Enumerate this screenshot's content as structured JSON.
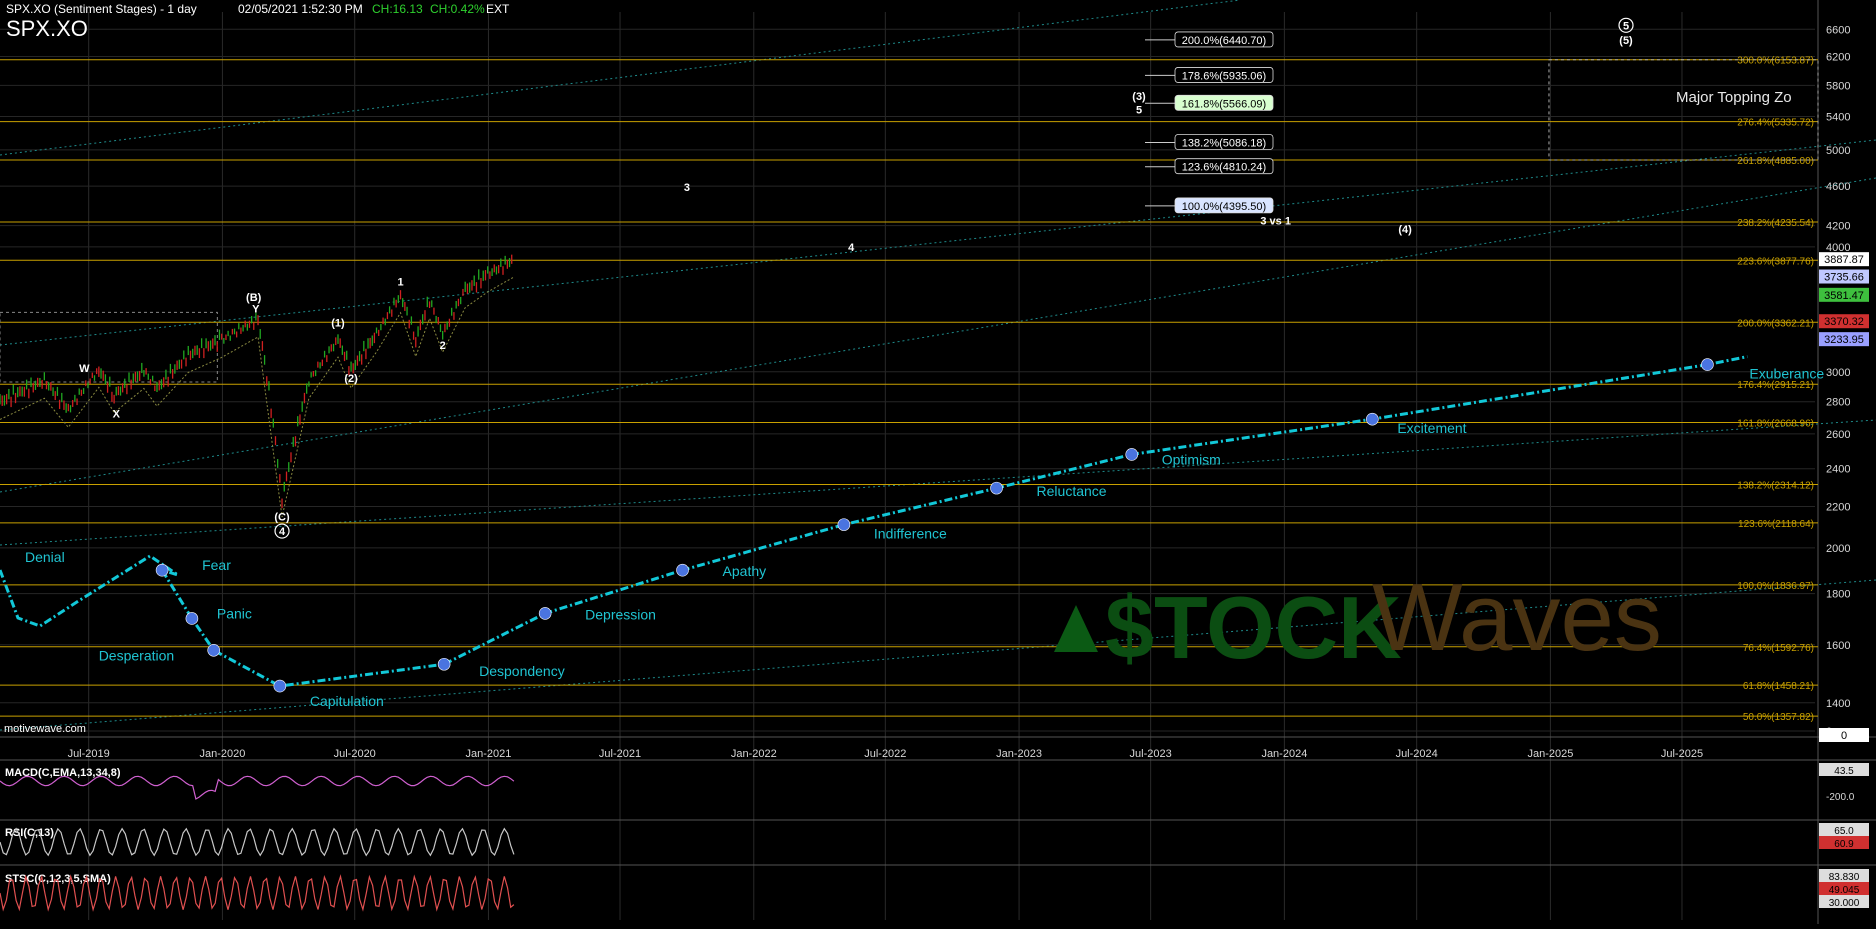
{
  "header": {
    "instrument": "SPX.XO (Sentiment Stages) - 1 day",
    "datetime": "02/05/2021 1:52:30 PM",
    "change": "CH:16.13",
    "change_pct": "CH:0.42%",
    "session": "EXT",
    "symbol": "SPX.XO"
  },
  "watermark": {
    "brand": "motivewave.com",
    "logo_part1": "$TOCK",
    "logo_part2": "Waves"
  },
  "colors": {
    "fib_line": "#c8a000",
    "sentiment_curve": "#12c8d8",
    "stage_marker": "#4a74e0",
    "stage_label": "#20c4d2",
    "up_candle": "#21a821",
    "down_candle": "#d02020"
  },
  "chart_data": [
    {
      "type": "line",
      "title": "SPX.XO (Sentiment Stages) - 1 day",
      "log_scale": true,
      "grid": true,
      "x_ticks": [
        "Jul-2019",
        "Jan-2020",
        "Jul-2020",
        "Jan-2021",
        "Jul-2021",
        "Jan-2022",
        "Jul-2022",
        "Jan-2023",
        "Jul-2023",
        "Jan-2024",
        "Jul-2024",
        "Jan-2025",
        "Jul-2025"
      ],
      "x_range": [
        "2019-03-01",
        "2025-12-31"
      ],
      "y_ticks": [
        6600,
        6200,
        5800,
        5400,
        5000,
        4600,
        4200,
        4000,
        3000,
        2800,
        2600,
        2400,
        2200,
        2000,
        1800,
        1600,
        1400,
        0
      ],
      "ylim": [
        1300,
        6900
      ],
      "price_series": {
        "name": "SPX",
        "x": [
          "2019-03-01",
          "2019-05-01",
          "2019-06-03",
          "2019-07-15",
          "2019-08-05",
          "2019-09-15",
          "2019-10-03",
          "2019-11-15",
          "2019-12-31",
          "2020-02-19",
          "2020-03-23",
          "2020-04-29",
          "2020-06-08",
          "2020-06-26",
          "2020-07-31",
          "2020-09-02",
          "2020-09-23",
          "2020-10-12",
          "2020-10-30",
          "2020-11-30",
          "2020-12-31",
          "2021-02-05"
        ],
        "y": [
          2800,
          2940,
          2750,
          3015,
          2845,
          3007,
          2887,
          3120,
          3230,
          3386,
          2237,
          2940,
          3232,
          3010,
          3271,
          3580,
          3237,
          3534,
          3270,
          3622,
          3756,
          3887
        ]
      },
      "price_labels": [
        {
          "text": "3887.87",
          "value": 3887.87,
          "color": "#ffffff"
        },
        {
          "text": "3735.66",
          "value": 3735.66,
          "color": "#c0c8ff"
        },
        {
          "text": "3581.47",
          "value": 3581.47,
          "color": "#3ec03e"
        },
        {
          "text": "3370.32",
          "value": 3370.32,
          "color": "#d03030"
        },
        {
          "text": "3233.95",
          "value": 3233.95,
          "color": "#9aa0ff"
        },
        {
          "text": "0",
          "value": 1300,
          "color": "#ffffff"
        }
      ],
      "fib_levels": [
        {
          "label": "300.0%(6153.87)",
          "value": 6153.87
        },
        {
          "label": "276.4%(5335.72)",
          "value": 5335.72
        },
        {
          "label": "261.8%(4885.00)",
          "value": 4885.0
        },
        {
          "label": "238.2%(4235.54)",
          "value": 4235.54
        },
        {
          "label": "223.6%(3877.76)",
          "value": 3877.76
        },
        {
          "label": "200.0%(3362.21)",
          "value": 3362.21
        },
        {
          "label": "176.4%(2915.21)",
          "value": 2915.21
        },
        {
          "label": "161.8%(2668.96)",
          "value": 2668.96
        },
        {
          "label": "138.2%(2314.12)",
          "value": 2314.12
        },
        {
          "label": "123.6%(2118.64)",
          "value": 2118.64
        },
        {
          "label": "100.0%(1836.97)",
          "value": 1836.97
        },
        {
          "label": "76.4%(1592.76)",
          "value": 1592.76
        },
        {
          "label": "61.8%(1458.21)",
          "value": 1458.21
        },
        {
          "label": "50.0%(1357.82)",
          "value": 1357.82
        }
      ],
      "extension_targets": [
        {
          "label": "200.0%(6440.70)",
          "value": 6440.7,
          "highlight": "none"
        },
        {
          "label": "178.6%(5935.06)",
          "value": 5935.06,
          "highlight": "none"
        },
        {
          "label": "161.8%(5566.09)",
          "value": 5566.09,
          "highlight": "green"
        },
        {
          "label": "138.2%(5086.18)",
          "value": 5086.18,
          "highlight": "none"
        },
        {
          "label": "123.6%(4810.24)",
          "value": 4810.24,
          "highlight": "none"
        },
        {
          "label": "100.0%(4395.50)",
          "value": 4395.5,
          "highlight": "blue"
        }
      ],
      "wave_labels": [
        {
          "text": "W",
          "x": "2019-06-25",
          "y": 3000
        },
        {
          "text": "X",
          "x": "2019-08-08",
          "y": 2700
        },
        {
          "text": "(B)",
          "x": "2020-02-13",
          "y": 3530
        },
        {
          "text": "Y",
          "x": "2020-02-16",
          "y": 3440
        },
        {
          "text": "(C)",
          "x": "2020-03-23",
          "y": 2130
        },
        {
          "text": "4",
          "x": "2020-03-23",
          "y": 2060,
          "circled": true
        },
        {
          "text": "(1)",
          "x": "2020-06-08",
          "y": 3330
        },
        {
          "text": "(2)",
          "x": "2020-06-26",
          "y": 2930
        },
        {
          "text": "1",
          "x": "2020-09-02",
          "y": 3660
        },
        {
          "text": "2",
          "x": "2020-10-30",
          "y": 3160
        },
        {
          "text": "3",
          "x": "2021-10-01",
          "y": 4550
        },
        {
          "text": "4",
          "x": "2022-05-15",
          "y": 3960
        },
        {
          "text": "(3)",
          "x": "2023-06-15",
          "y": 5610
        },
        {
          "text": "5",
          "x": "2023-06-15",
          "y": 5440
        },
        {
          "text": "3 vs 1",
          "x": "2023-12-20",
          "y": 4210
        },
        {
          "text": "(4)",
          "x": "2024-06-15",
          "y": 4130
        },
        {
          "text": "5",
          "x": "2025-04-15",
          "y": 6600,
          "circled": true
        },
        {
          "text": "(5)",
          "x": "2025-04-15",
          "y": 6380
        }
      ],
      "zones": [
        {
          "label": "Major Topping Zo",
          "x0": "2024-12-30",
          "x1": "2026-01-30",
          "y0": 4885.0,
          "y1": 6153.87
        }
      ],
      "sentiment_stages": [
        {
          "name": "Denial",
          "x": "2019-03-01",
          "y": 1960
        },
        {
          "name": "Fear",
          "x": "2019-10-10",
          "y": 1900
        },
        {
          "name": "Panic",
          "x": "2019-11-20",
          "y": 1700
        },
        {
          "name": "Desperation",
          "x": "2019-12-20",
          "y": 1580
        },
        {
          "name": "Capitulation",
          "x": "2020-03-20",
          "y": 1455
        },
        {
          "name": "Despondency",
          "x": "2020-11-01",
          "y": 1530
        },
        {
          "name": "Depression",
          "x": "2021-03-20",
          "y": 1720
        },
        {
          "name": "Apathy",
          "x": "2021-09-25",
          "y": 1900
        },
        {
          "name": "Indifference",
          "x": "2022-05-05",
          "y": 2110
        },
        {
          "name": "Reluctance",
          "x": "2022-12-01",
          "y": 2295
        },
        {
          "name": "Optimism",
          "x": "2023-06-05",
          "y": 2480
        },
        {
          "name": "Excitement",
          "x": "2024-05-01",
          "y": 2690
        },
        {
          "name": "Exuberance",
          "x": "2025-08-05",
          "y": 3050
        }
      ]
    },
    {
      "type": "line",
      "title": "MACD(C,EMA,13,34,8)",
      "y_ticks": [
        -200.0
      ],
      "value_label": "43.5"
    },
    {
      "type": "line",
      "title": "RSI(C,13)",
      "value_labels": [
        "65.0",
        "60.9"
      ]
    },
    {
      "type": "line",
      "title": "STSC(C,12,3,5,SMA)",
      "value_labels": [
        "83.830",
        "49.045",
        "30.000"
      ]
    }
  ]
}
